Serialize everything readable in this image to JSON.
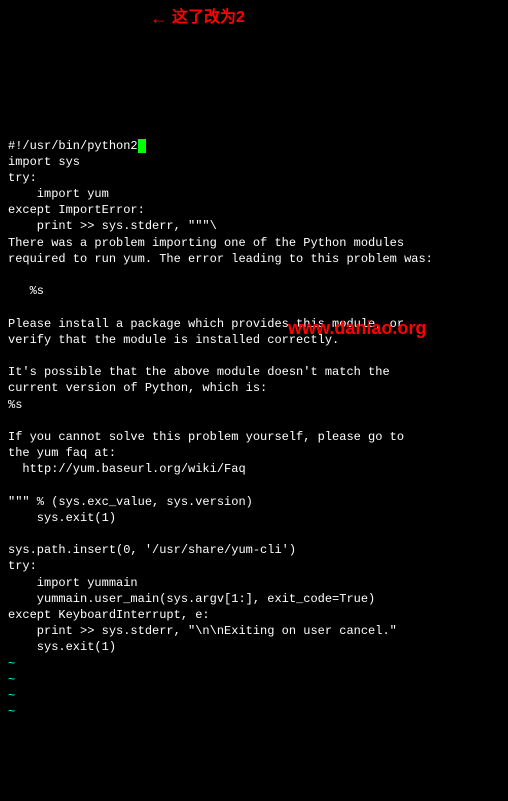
{
  "code": {
    "line1": "#!/usr/bin/python2",
    "line2": "import sys",
    "line3": "try:",
    "line4": "    import yum",
    "line5": "except ImportError:",
    "line6": "    print >> sys.stderr, \"\"\"\\",
    "line7": "There was a problem importing one of the Python modules",
    "line8": "required to run yum. The error leading to this problem was:",
    "line9": "",
    "line10": "   %s",
    "line11": "",
    "line12": "Please install a package which provides this module, or",
    "line13": "verify that the module is installed correctly.",
    "line14": "",
    "line15": "It's possible that the above module doesn't match the",
    "line16": "current version of Python, which is:",
    "line17": "%s",
    "line18": "",
    "line19": "If you cannot solve this problem yourself, please go to",
    "line20": "the yum faq at:",
    "line21": "  http://yum.baseurl.org/wiki/Faq",
    "line22": "",
    "line23": "\"\"\" % (sys.exc_value, sys.version)",
    "line24": "    sys.exit(1)",
    "line25": "",
    "line26": "sys.path.insert(0, '/usr/share/yum-cli')",
    "line27": "try:",
    "line28": "    import yummain",
    "line29": "    yummain.user_main(sys.argv[1:], exit_code=True)",
    "line30": "except KeyboardInterrupt, e:",
    "line31": "    print >> sys.stderr, \"\\n\\nExiting on user cancel.\"",
    "line32": "    sys.exit(1)",
    "tilde": "~"
  },
  "annotation": {
    "text": "这了改为2"
  },
  "watermark": {
    "text": "www.daniao.org"
  }
}
